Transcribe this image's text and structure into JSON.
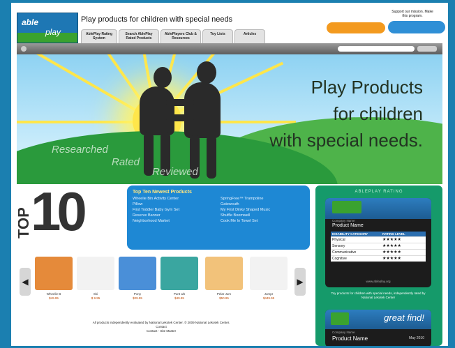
{
  "header": {
    "logo_text_1": "able",
    "logo_text_2": "play",
    "tagline": "Play products for children with special needs",
    "support_text": "Support our mission. Make this program."
  },
  "tabs": [
    {
      "label": "AblePlay Rating System"
    },
    {
      "label": "Search AblePlay Rated Products"
    },
    {
      "label": "AblePlayers Club & Resources"
    },
    {
      "label": "Toy Lists"
    },
    {
      "label": "Articles"
    }
  ],
  "hero": {
    "title_line1": "Play Products",
    "title_line2": "for children",
    "title_line3": "with special needs.",
    "word1": "Researched",
    "word2": "Rated",
    "word3": "Reviewed"
  },
  "top10": {
    "top": "TOP",
    "ten": "10"
  },
  "newest": {
    "title": "Top Ten Newest Products",
    "items": [
      "Wheelie Bin Activity Center",
      "SpringFree™ Trampoline",
      "Pillow",
      "Gatewouth",
      "First Toddler Baby Gym Set",
      "My First Dinky Shaped Music",
      "Reserve Banner",
      "Shuffle Boomwell",
      "Neighborhood Market",
      "Cook Me In Towel Set"
    ]
  },
  "products": [
    {
      "name": "Wheelie B",
      "price": "$49.95",
      "color": "#e58a3a"
    },
    {
      "name": "Ski",
      "price": "$ 9.95",
      "color": "#f2f2f2"
    },
    {
      "name": "Pony",
      "price": "$29.95",
      "color": "#4a8fd8"
    },
    {
      "name": "Punt wb",
      "price": "$49.95",
      "color": "#3aa6a0"
    },
    {
      "name": "Pelar Jum",
      "price": "$50.95",
      "color": "#f2c27a"
    },
    {
      "name": "Jumpr",
      "price": "$449.95",
      "color": "#f2f2f2"
    }
  ],
  "footer": {
    "line1": "All products independently evaluated by National Lekotek Center. © 2009 National Lekotek Center.",
    "line2": "Contact",
    "line3": "Contact - Site Master"
  },
  "panel": {
    "title": "ABLEPLAY RATING",
    "card_small": "Company Name",
    "card_name": "Product Name",
    "rating_head_1": "DISABILITY CATEGORY",
    "rating_head_2": "RATING LEVEL",
    "ratings": [
      {
        "category": "Physical",
        "stars": "★★★★★"
      },
      {
        "category": "Sensory",
        "stars": "★★★★★"
      },
      {
        "category": "Communicative",
        "stars": "★★★★★"
      },
      {
        "category": "Cognitive",
        "stars": "★★★★★"
      }
    ],
    "url": "www.ableplay.org",
    "panel_text": "Toy products for children with special needs, independently rated by National Lekotek Center",
    "card2_great": "great find!",
    "card2_small": "Company Name",
    "card2_name": "Product Name",
    "card2_date": "May 2010"
  }
}
